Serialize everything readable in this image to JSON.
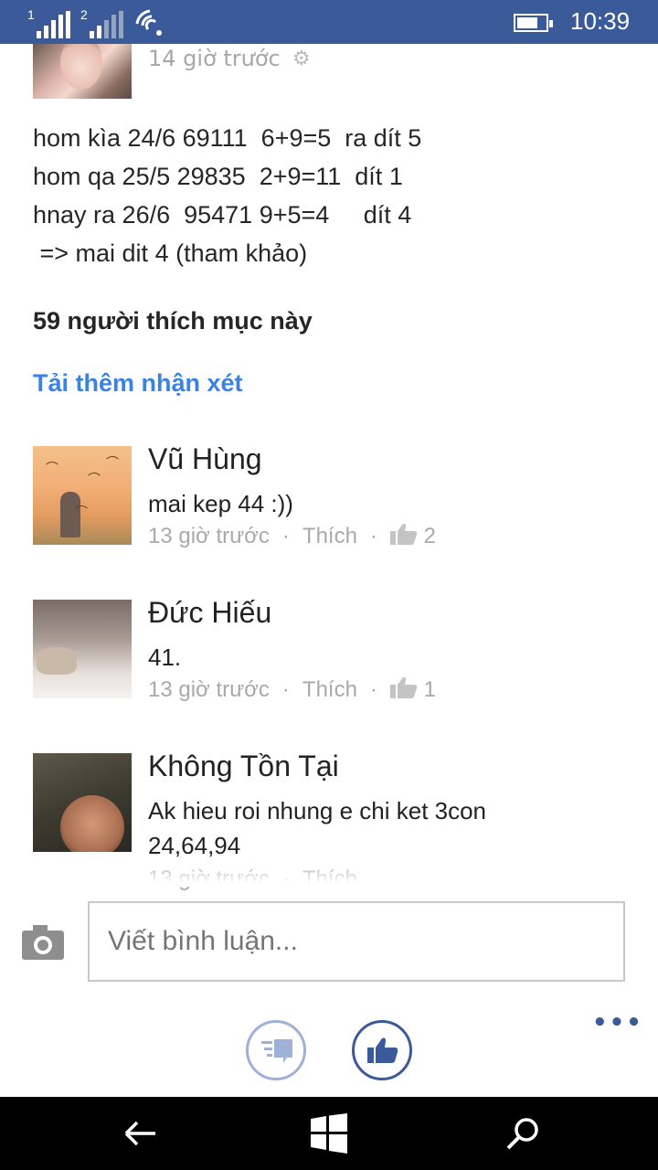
{
  "status_bar": {
    "sim1": "1",
    "sim2": "2",
    "time": "10:39"
  },
  "post": {
    "time": "14 giờ trước",
    "body": "hom kìa 24/6 69111  6+9=5  ra dít 5\nhom qa 25/5 29835  2+9=11  dít 1\nhnay ra 26/6  95471 9+5=4     dít 4\n => mai dit 4 (tham khảo)",
    "likes_text": "59 người thích mục này",
    "load_more": "Tải thêm nhận xét"
  },
  "comments": [
    {
      "name": "Vũ Hùng",
      "text": "mai kep 44 :))",
      "time": "13 giờ trước",
      "like_label": "Thích",
      "like_count": "2"
    },
    {
      "name": "Đức Hiếu",
      "text": "41.",
      "time": "13 giờ trước",
      "like_label": "Thích",
      "like_count": "1"
    },
    {
      "name": "Không Tồn Tại",
      "text": "Ak hieu roi nhung e chi ket 3con\n24,64,94",
      "time": "13 giờ trước",
      "like_label": "Thích"
    }
  ],
  "composer": {
    "placeholder": "Viết bình luận..."
  },
  "app_bar": {
    "more": "•••"
  },
  "colors": {
    "header_bg": "#3b5a99",
    "link": "#3a82e4",
    "muted": "#a9a9a9"
  }
}
